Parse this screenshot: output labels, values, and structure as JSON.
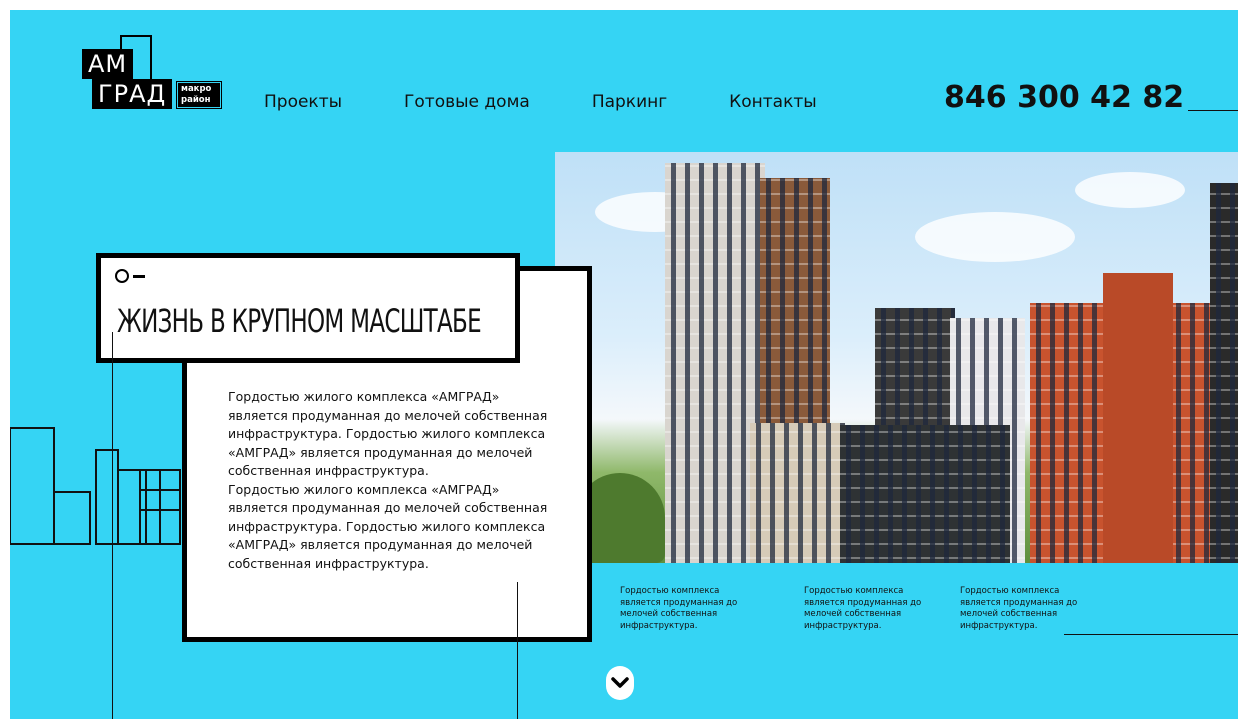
{
  "logo": {
    "line1": "АМ",
    "line2": "ГРАД",
    "sub1": "макро",
    "sub2": "район"
  },
  "nav": {
    "items": [
      {
        "label": "Проекты"
      },
      {
        "label": "Готовые дома"
      },
      {
        "label": "Паркинг"
      },
      {
        "label": "Контакты"
      }
    ]
  },
  "phone": "846 300 42 82",
  "hero": {
    "title": "ЖИЗНЬ В КРУПНОМ МАСШТАБЕ",
    "paragraphs": [
      "Гордостью жилого комплекса «АМГРАД» является продуманная до мелочей собственная инфраструктура. Гордостью жилого комплекса «АМГРАД» является продуманная до мелочей собственная инфраструктура.",
      "Гордостью жилого комплекса «АМГРАД» является продуманная до мелочей собственная инфраструктура. Гордостью жилого комплекса «АМГРАД» является продуманная до мелочей собственная инфраструктура."
    ]
  },
  "captions": [
    "Гордостью  комплекса является продуманная до мелочей собственная инфраструктура.",
    "Гордостью  комплекса является продуманная до мелочей собственная инфраструктура.",
    "Гордостью  комплекса является продуманная до мелочей собственная инфраструктура."
  ],
  "colors": {
    "background": "#35d4f4",
    "ink": "#111111",
    "card": "#ffffff"
  },
  "icons": {
    "scroll": "chevron-down-icon",
    "title_mark": "circle-dash-icon"
  }
}
